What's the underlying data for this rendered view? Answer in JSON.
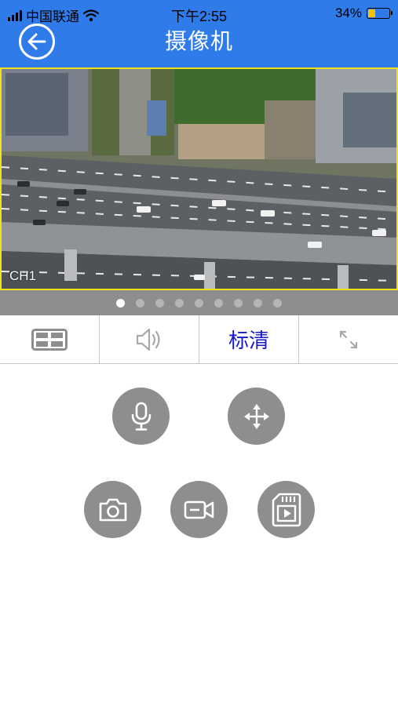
{
  "status_bar": {
    "carrier": "中国联通",
    "time": "下午2:55",
    "battery": "34%",
    "battery_level": 0.34
  },
  "header": {
    "title": "摄像机",
    "back_icon": "back-arrow-icon"
  },
  "video": {
    "channel_label": "CH1",
    "border_color": "#f2e21c"
  },
  "pager": {
    "total": 9,
    "active_index": 0
  },
  "toolbar": {
    "layout_icon": "grid-layout-icon",
    "audio_icon": "speaker-icon",
    "quality_label": "标清",
    "fullscreen_icon": "expand-icon"
  },
  "controls": {
    "talk_icon": "microphone-icon",
    "ptz_icon": "ptz-arrows-icon",
    "snapshot_icon": "camera-icon",
    "record_icon": "video-record-icon",
    "playback_icon": "sd-card-playback-icon"
  },
  "colors": {
    "header_bg": "#2f7bea",
    "quality_text": "#1919c8",
    "control_bg": "#8e8e8e"
  }
}
